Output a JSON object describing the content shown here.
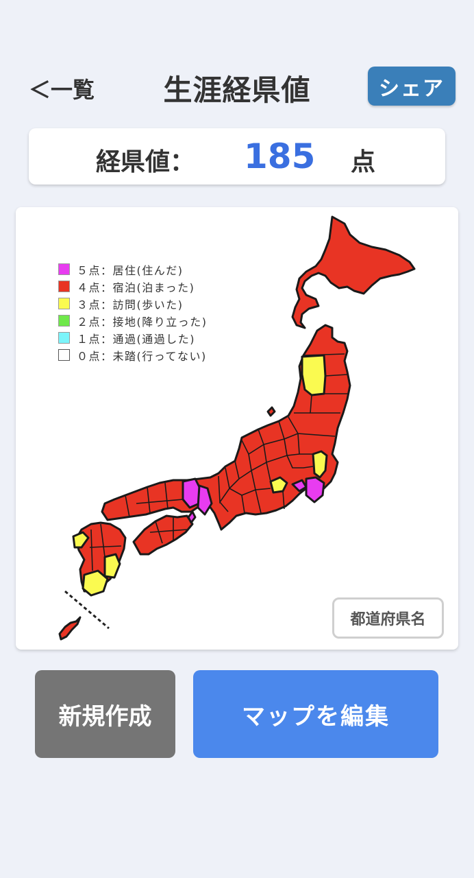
{
  "header": {
    "back_label": "＜一覧",
    "title": "生涯経県値",
    "share_label": "シェア"
  },
  "score": {
    "label": "経県値：",
    "value": "185",
    "unit": "点"
  },
  "legend": [
    {
      "text": "５点：居住(住んだ)",
      "color": "#e83cf0"
    },
    {
      "text": "４点：宿泊(泊まった)",
      "color": "#e83424"
    },
    {
      "text": "３点：訪問(歩いた)",
      "color": "#fafa50"
    },
    {
      "text": "２点：接地(降り立った)",
      "color": "#6fe84a"
    },
    {
      "text": "１点：通過(通過した)",
      "color": "#7cf4fa"
    },
    {
      "text": "０点：未踏(行ってない)",
      "color": "#ffffff"
    }
  ],
  "map": {
    "prefecture_names_button": "都道府県名"
  },
  "actions": {
    "new_label": "新規作成",
    "edit_label": "マップを編集"
  },
  "colors": {
    "level5": "#e83cf0",
    "level4": "#e83424",
    "level3": "#fafa50",
    "accent_blue": "#4b88ec",
    "share_blue": "#3a7fb9"
  }
}
